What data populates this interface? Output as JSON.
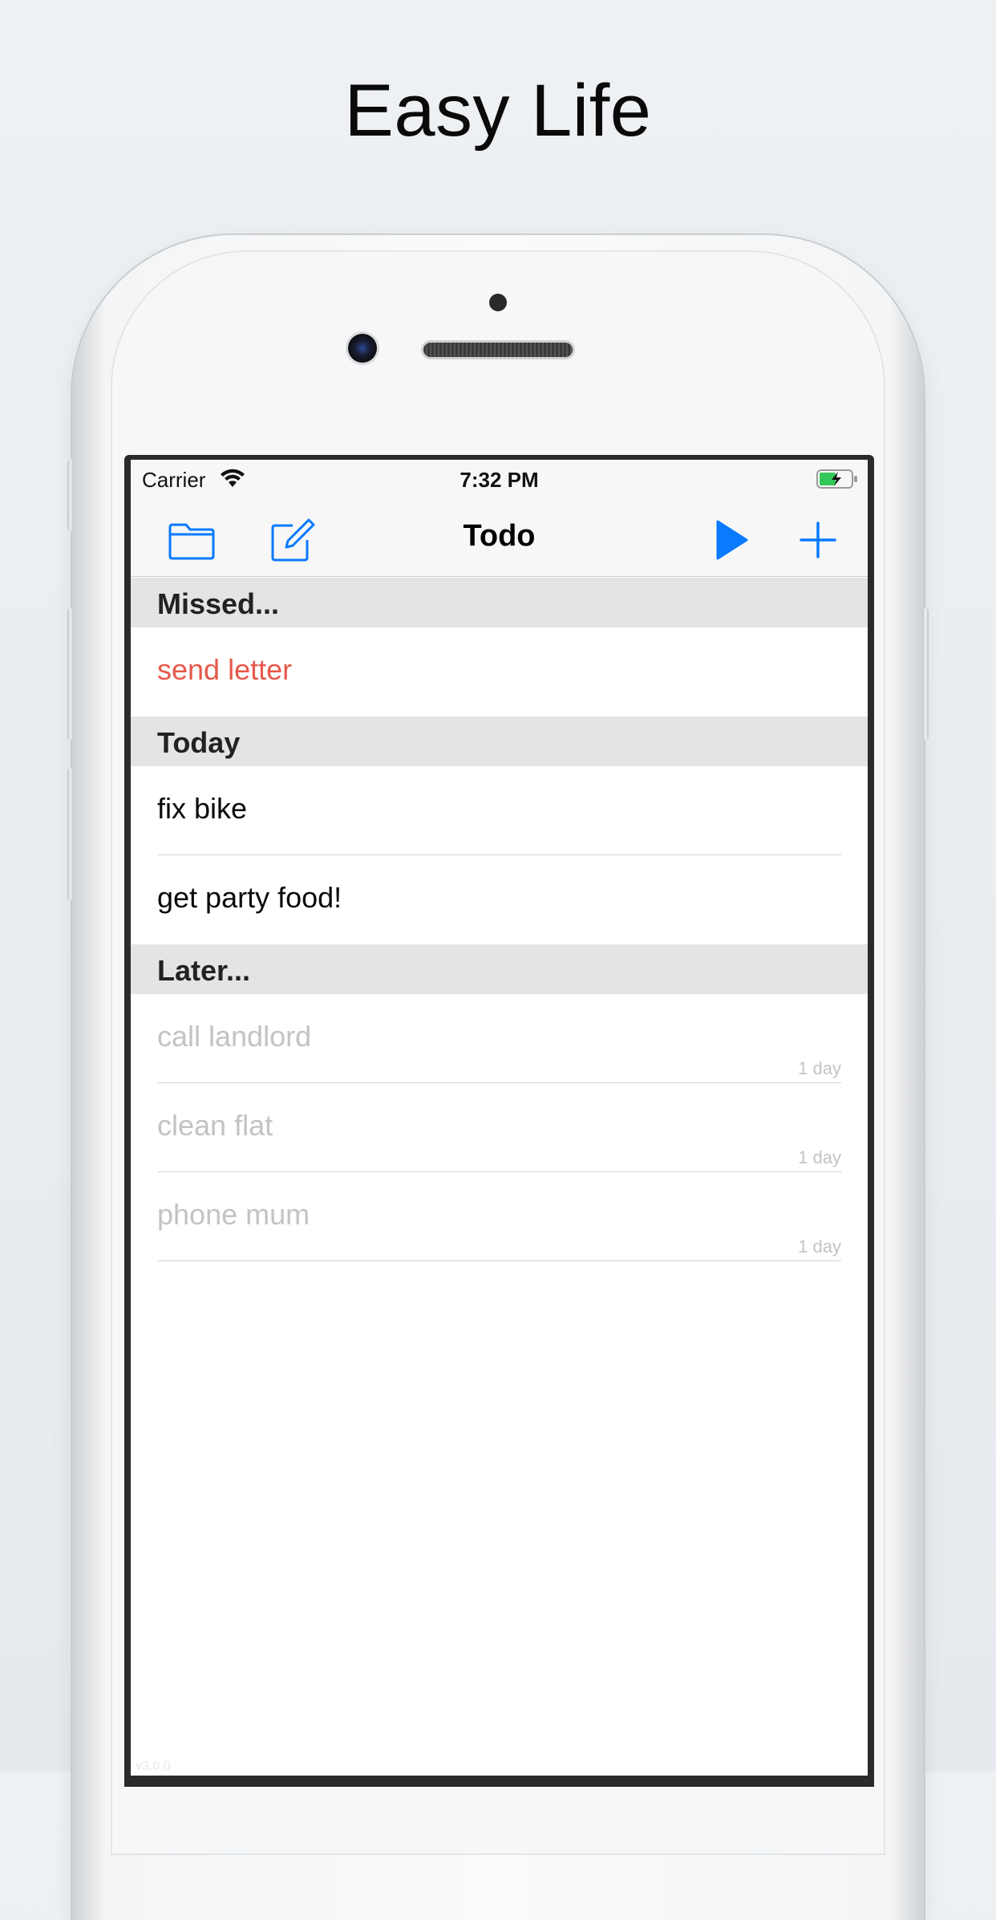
{
  "headline": "Easy Life",
  "status_bar": {
    "carrier": "Carrier",
    "time": "7:32 PM",
    "wifi_icon": "wifi-icon",
    "battery_icon": "battery-charging-icon"
  },
  "nav": {
    "title": "Todo",
    "left_buttons": [
      "folder-icon",
      "compose-icon"
    ],
    "right_buttons": [
      "play-icon",
      "plus-icon"
    ],
    "accent_color": "#0a7aff"
  },
  "sections": [
    {
      "title": "Missed...",
      "items": [
        {
          "text": "send letter",
          "style": "missed",
          "sub": ""
        }
      ]
    },
    {
      "title": "Today",
      "items": [
        {
          "text": "fix bike",
          "style": "normal",
          "sub": ""
        },
        {
          "text": "get party food!",
          "style": "normal",
          "sub": ""
        }
      ]
    },
    {
      "title": "Later...",
      "items": [
        {
          "text": "call landlord",
          "style": "later",
          "sub": "1 day"
        },
        {
          "text": "clean flat",
          "style": "later",
          "sub": "1 day"
        },
        {
          "text": "phone mum",
          "style": "later",
          "sub": "1 day"
        }
      ]
    }
  ],
  "footer": {
    "version": "v3.0.0"
  },
  "colors": {
    "missed": "#e5594b",
    "later": "#c3c3c3",
    "section_bg": "#e4e4e4"
  }
}
